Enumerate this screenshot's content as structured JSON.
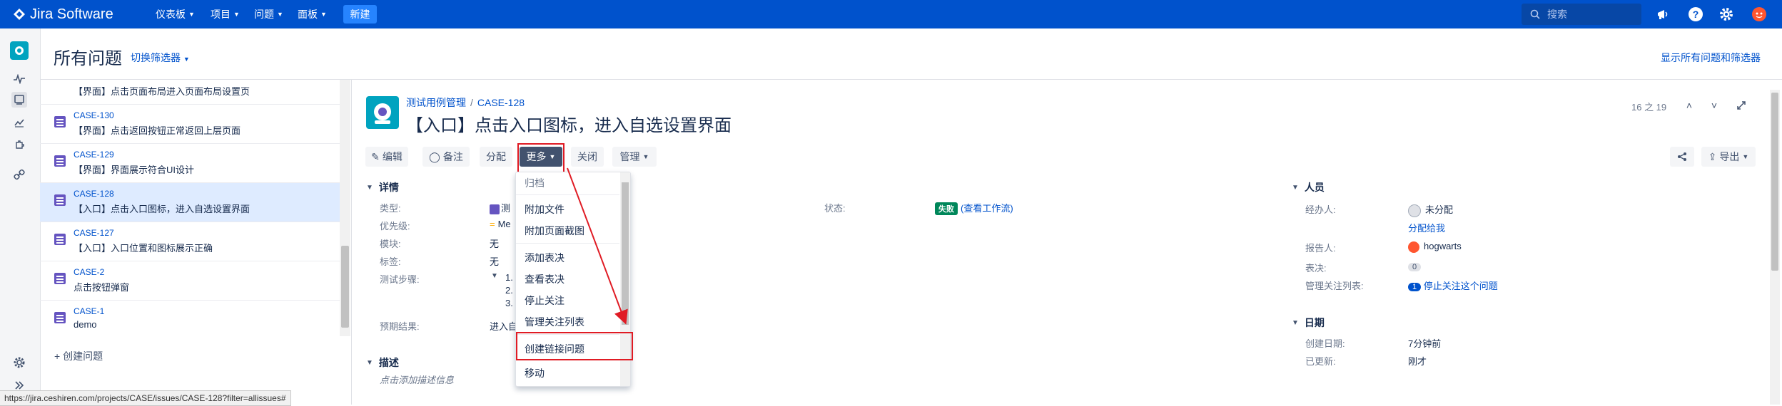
{
  "topnav": {
    "brand": "Jira Software",
    "items": [
      "仪表板",
      "项目",
      "问题",
      "面板"
    ],
    "create": "新建",
    "search_placeholder": "搜索",
    "colors": {
      "nav": "#0052cc",
      "create": "#2684ff"
    }
  },
  "header": {
    "title": "所有问题",
    "switch_filter": "切换筛选器",
    "show_all": "显示所有问题和筛选器"
  },
  "issue_list": [
    {
      "key": "",
      "summary": "【界面】点击页面布局进入页面布局设置页"
    },
    {
      "key": "CASE-130",
      "summary": "【界面】点击返回按钮正常返回上层页面"
    },
    {
      "key": "CASE-129",
      "summary": "【界面】界面展示符合UI设计"
    },
    {
      "key": "CASE-128",
      "summary": "【入口】点击入口图标，进入自选设置界面",
      "selected": true
    },
    {
      "key": "CASE-127",
      "summary": "【入口】入口位置和图标展示正确"
    },
    {
      "key": "CASE-2",
      "summary": "点击按钮弹窗"
    },
    {
      "key": "CASE-1",
      "summary": "demo"
    }
  ],
  "create_issue": "+ 创建问题",
  "status_url": "https://jira.ceshiren.com/projects/CASE/issues/CASE-128?filter=allissues#",
  "issue": {
    "project": "测试用例管理",
    "key": "CASE-128",
    "title": "【入口】点击入口图标，进入自选设置界面",
    "pager": "16 之 19",
    "buttons": {
      "edit": "编辑",
      "comment": "备注",
      "assign": "分配",
      "more": "更多",
      "close": "关闭",
      "admin": "管理",
      "export": "导出"
    },
    "details_title": "详情",
    "fields": {
      "type_label": "类型:",
      "type_value": "测",
      "priority_label": "优先级:",
      "priority_value": "Me",
      "module_label": "模块:",
      "module_value": "无",
      "tags_label": "标签:",
      "tags_value": "无",
      "steps_label": "测试步骤:",
      "steps": [
        "1.",
        "2.",
        "3."
      ],
      "expected_label": "预期结果:",
      "expected_value": "进入自"
    },
    "status_label": "状态:",
    "status_value": "失败",
    "status_link": "(查看工作流)",
    "description_title": "描述",
    "description_placeholder": "点击添加描述信息",
    "people": {
      "title": "人员",
      "assignee_label": "经办人:",
      "assignee_value": "未分配",
      "assign_me": "分配给我",
      "reporter_label": "报告人:",
      "reporter_value": "hogwarts",
      "votes_label": "表决:",
      "votes_value": "0",
      "watchers_label": "管理关注列表:",
      "watchers_count": "1",
      "watchers_link": "停止关注这个问题"
    },
    "dates": {
      "title": "日期",
      "created_label": "创建日期:",
      "created_value": "7分钟前",
      "updated_label": "已更新:",
      "updated_value": "刚才"
    }
  },
  "more_menu": [
    "归档",
    "附加文件",
    "附加页面截图",
    "添加表决",
    "查看表决",
    "停止关注",
    "管理关注列表",
    "创建链接问题",
    "移动"
  ],
  "annotation_color": "#e01b24"
}
